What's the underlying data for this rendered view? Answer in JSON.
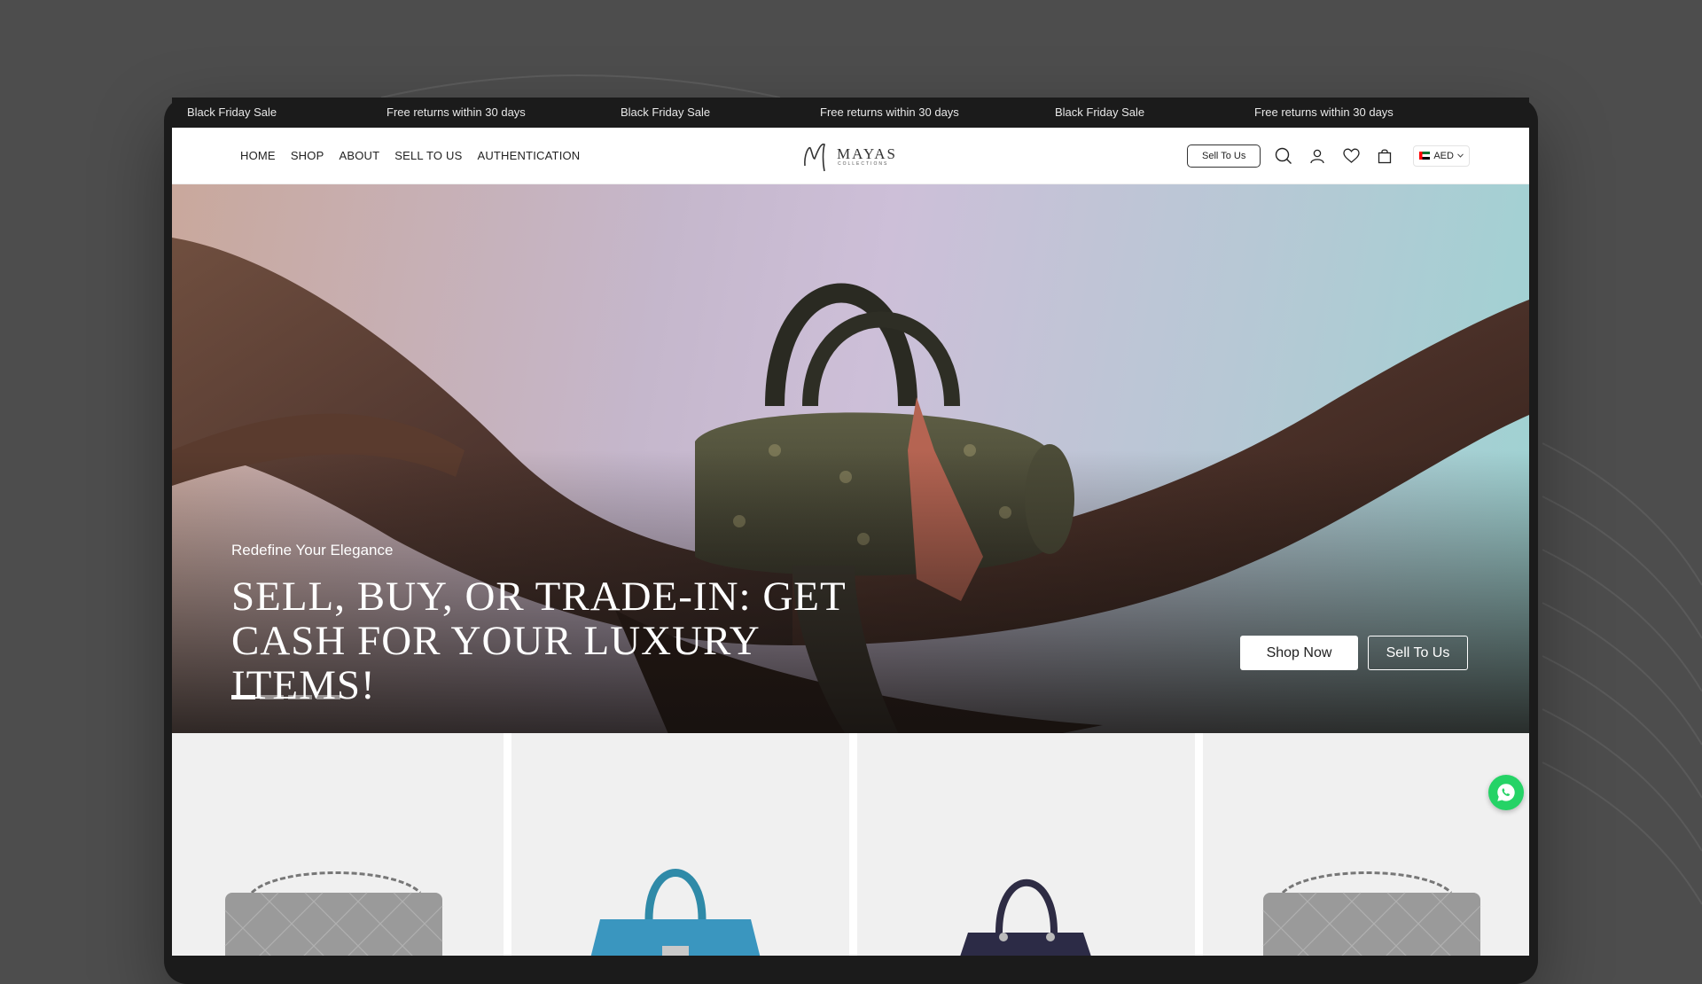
{
  "announcement_bar": {
    "items": [
      "Black Friday Sale",
      "Free returns within 30 days",
      "Black Friday Sale",
      "Free returns within 30 days",
      "Black Friday Sale",
      "Free returns within 30 days"
    ]
  },
  "nav": {
    "links": [
      "HOME",
      "SHOP",
      "ABOUT",
      "SELL TO US",
      "AUTHENTICATION"
    ],
    "logo_text": "MAYAS",
    "logo_subtext": "COLLECTIONS",
    "sell_button": "Sell To Us",
    "currency": "AED",
    "icons": [
      "search-icon",
      "account-icon",
      "wishlist-icon",
      "cart-icon",
      "chevron-down-icon"
    ]
  },
  "hero": {
    "eyebrow": "Redefine Your Elegance",
    "headline_line1": "SELL, BUY, OR TRADE-IN: GET",
    "headline_line2": "CASH FOR YOUR LUXURY ITEMS!",
    "primary_button": "Shop Now",
    "secondary_button": "Sell To Us",
    "slides_total": 4,
    "active_slide": 1
  },
  "products": [
    {
      "name": "quilted-flap-bag-grey"
    },
    {
      "name": "top-handle-bag-blue"
    },
    {
      "name": "lady-bag-navy"
    },
    {
      "name": "quilted-flap-bag-grey"
    }
  ],
  "colors": {
    "background": "#4d4d4d",
    "announcement_bg": "#1b1b1b",
    "whatsapp": "#25d366"
  }
}
